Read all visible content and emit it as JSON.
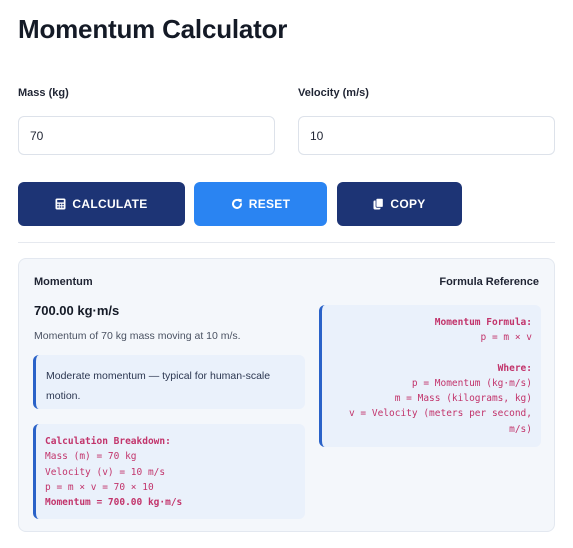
{
  "app": {
    "title": "Momentum Calculator"
  },
  "inputs": {
    "mass": {
      "label": "Mass (kg)",
      "value": "70"
    },
    "velocity": {
      "label": "Velocity (m/s)",
      "value": "10"
    }
  },
  "buttons": {
    "calculate": {
      "label": "CALCULATE",
      "icon": "calculator-icon"
    },
    "reset": {
      "label": "RESET",
      "icon": "redo-icon"
    },
    "copy": {
      "label": "COPY",
      "icon": "copy-icon"
    }
  },
  "colors": {
    "primary": "#1d3475",
    "accent": "#2a84f2",
    "code": "#c2346b",
    "border_accent": "#2a62c8"
  },
  "result": {
    "heading": "Momentum",
    "value": "700.00 kg·m/s",
    "description": "Momentum of 70 kg mass moving at 10 m/s.",
    "note": "Moderate momentum — typical for human-scale motion.",
    "breakdown": {
      "title": "Calculation Breakdown:",
      "lines": [
        "Mass (m) = 70 kg",
        "Velocity (v) = 10 m/s",
        "p = m × v = 70 × 10"
      ],
      "total": "Momentum = 700.00 kg·m/s"
    }
  },
  "reference": {
    "heading": "Formula Reference",
    "formula_title": "Momentum Formula:",
    "formula": "p = m × v",
    "where_title": "Where:",
    "where_lines": [
      "p = Momentum (kg·m/s)",
      "m = Mass (kilograms, kg)",
      "v = Velocity (meters per second,",
      "m/s)"
    ]
  }
}
